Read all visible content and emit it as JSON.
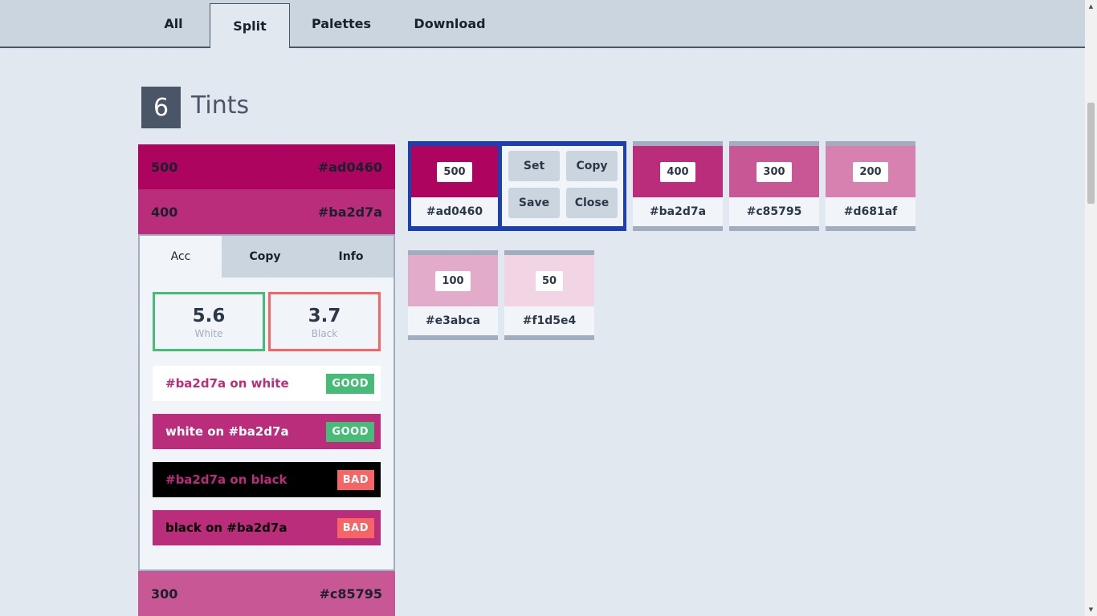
{
  "top_tabs": [
    "All",
    "Split",
    "Palettes",
    "Download"
  ],
  "heading": {
    "count": "6",
    "title": "Tints"
  },
  "list_rows": [
    {
      "label": "500",
      "hex": "#ad0460",
      "color": "#ad0460"
    },
    {
      "label": "400",
      "hex": "#ba2d7a",
      "color": "#ba2d7a"
    },
    {
      "label": "300",
      "hex": "#c85795",
      "color": "#c85795"
    }
  ],
  "panel": {
    "tabs": [
      "Acc",
      "Copy",
      "Info"
    ],
    "ratios": [
      {
        "value": "5.6",
        "label": "White",
        "border": "#48bb78"
      },
      {
        "value": "3.7",
        "label": "Black",
        "border": "#f56565"
      }
    ],
    "checks": [
      {
        "text": "#ba2d7a on white",
        "badge": "GOOD",
        "bg": "#ffffff",
        "fg": "#ba2d7a",
        "badge_color": "#48bb78"
      },
      {
        "text": "white on #ba2d7a",
        "badge": "GOOD",
        "bg": "#ba2d7a",
        "fg": "#ffffff",
        "badge_color": "#48bb78"
      },
      {
        "text": "#ba2d7a on black",
        "badge": "BAD",
        "bg": "#000000",
        "fg": "#ba2d7a",
        "badge_color": "#f56565"
      },
      {
        "text": "black on #ba2d7a",
        "badge": "BAD",
        "bg": "#ba2d7a",
        "fg": "#000000",
        "badge_color": "#f56565"
      }
    ]
  },
  "selected": {
    "label": "500",
    "hex": "#ad0460",
    "color": "#ad0460",
    "actions": [
      "Set",
      "Copy",
      "Save",
      "Close"
    ]
  },
  "swatches": [
    {
      "label": "400",
      "hex": "#ba2d7a",
      "color": "#ba2d7a"
    },
    {
      "label": "300",
      "hex": "#c85795",
      "color": "#c85795"
    },
    {
      "label": "200",
      "hex": "#d681af",
      "color": "#d681af"
    },
    {
      "label": "100",
      "hex": "#e3abca",
      "color": "#e3abca"
    },
    {
      "label": "50",
      "hex": "#f1d5e4",
      "color": "#f1d5e4"
    }
  ]
}
